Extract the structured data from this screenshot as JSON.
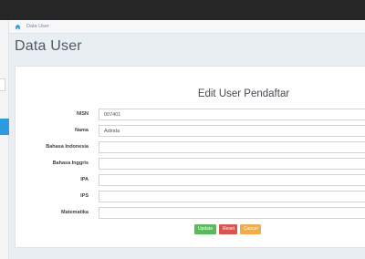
{
  "breadcrumb": {
    "current": "Data User"
  },
  "page": {
    "title": "Data User"
  },
  "form": {
    "title": "Edit User Pendaftar",
    "fields": [
      {
        "label": "NISN",
        "value": "007401"
      },
      {
        "label": "Nama",
        "value": "Adinda"
      },
      {
        "label": "Bahasa Indonesia",
        "value": ""
      },
      {
        "label": "Bahasa Inggris",
        "value": ""
      },
      {
        "label": "IPA",
        "value": ""
      },
      {
        "label": "IPS",
        "value": ""
      },
      {
        "label": "Matematika",
        "value": ""
      }
    ],
    "buttons": {
      "update": "Update",
      "reset": "Reset",
      "cancel": "Cancel"
    }
  },
  "colors": {
    "topbar": "#262626",
    "accent": "#2e9be0",
    "update": "#5cb85c",
    "reset": "#d9534f",
    "cancel": "#f0ad4e"
  },
  "icons": {
    "breadcrumb_home": "home-icon"
  }
}
